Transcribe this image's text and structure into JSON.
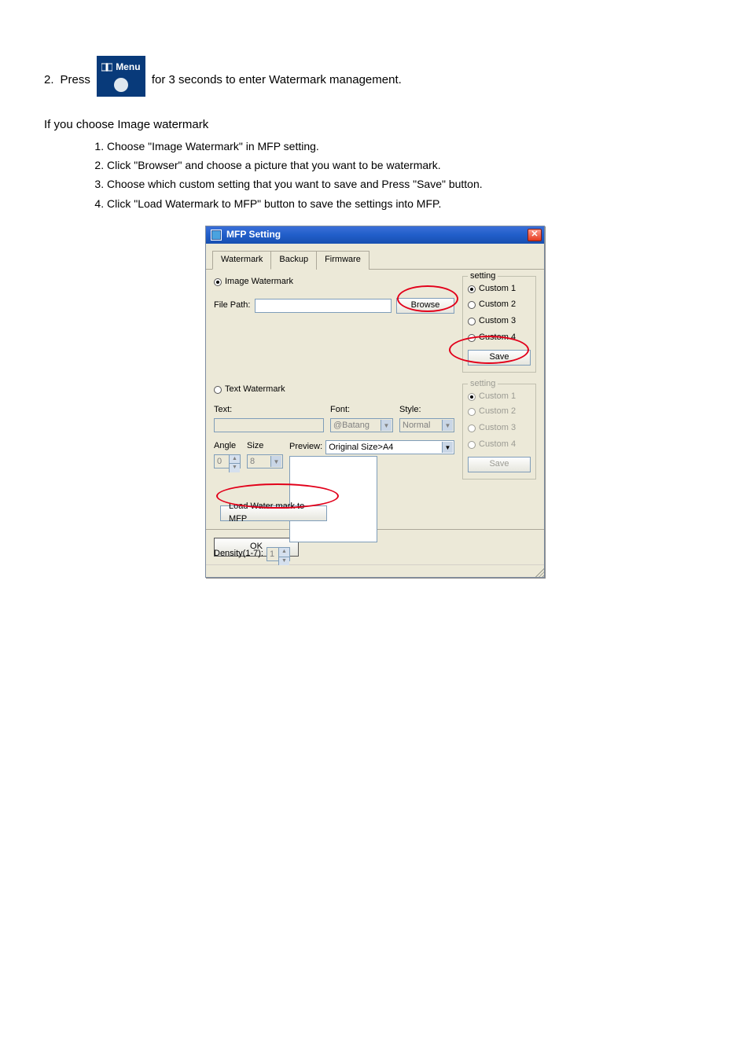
{
  "page": {
    "heading_prefix": "2.",
    "heading": "Press",
    "heading_suffix": "for 3 seconds to enter Watermark management.",
    "para1": "If you choose Image watermark",
    "sub_items": [
      "Choose \"Image Watermark\" in MFP setting.",
      "Click \"Browser\" and choose a picture that you want to be watermark.",
      "Choose which custom setting that you want to save and Press \"Save\" button.",
      "Click \"Load Watermark to MFP\" button to save the settings into MFP."
    ],
    "menu_label": "Menu"
  },
  "win": {
    "title": "MFP Setting",
    "tabs": [
      "Watermark",
      "Backup",
      "Firmware"
    ],
    "image_watermark_label": "Image Watermark",
    "file_path_label": "File Path:",
    "file_path_value": "",
    "browse_label": "Browse",
    "setting1": {
      "legend": "setting",
      "options": [
        "Custom 1",
        "Custom 2",
        "Custom 3",
        "Custom 4"
      ],
      "save_label": "Save"
    },
    "text_watermark_label": "Text Watermark",
    "text_label": "Text:",
    "font_label": "Font:",
    "font_value": "@Batang",
    "style_label": "Style:",
    "style_value": "Normal",
    "angle_label": "Angle",
    "size_label": "Size",
    "angle_value": "0",
    "size_value": "8",
    "preview_label": "Preview:",
    "orig_size_value": "Original Size>A4",
    "density_label": "Density(1-7):",
    "density_value": "1",
    "setting2": {
      "legend": "setting",
      "options": [
        "Custom 1",
        "Custom 2",
        "Custom 3",
        "Custom 4"
      ],
      "save_label": "Save"
    },
    "load_label": "Load  Water mark to MFP",
    "ok_label": "OK"
  }
}
